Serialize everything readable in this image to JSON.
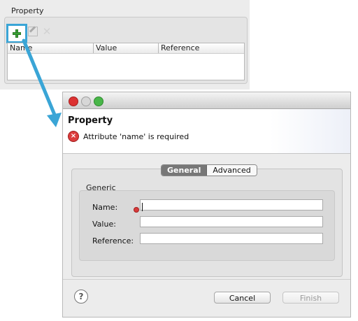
{
  "top_panel": {
    "title": "Property",
    "columns": [
      "Name",
      "Value",
      "Reference"
    ],
    "add_icon": "plus-icon",
    "edit_icon": "edit-icon",
    "delete_icon": "delete-icon",
    "highlight_color": "#3aa5d6"
  },
  "dialog": {
    "title": "Property",
    "error": "Attribute 'name' is required",
    "tabs": [
      "General",
      "Advanced"
    ],
    "section": "Generic",
    "fields": [
      {
        "label": "Name:",
        "value": ""
      },
      {
        "label": "Value:",
        "value": ""
      },
      {
        "label": "Reference:",
        "value": ""
      }
    ],
    "buttons": {
      "cancel": "Cancel",
      "finish": "Finish"
    },
    "help_icon": "question-icon"
  }
}
